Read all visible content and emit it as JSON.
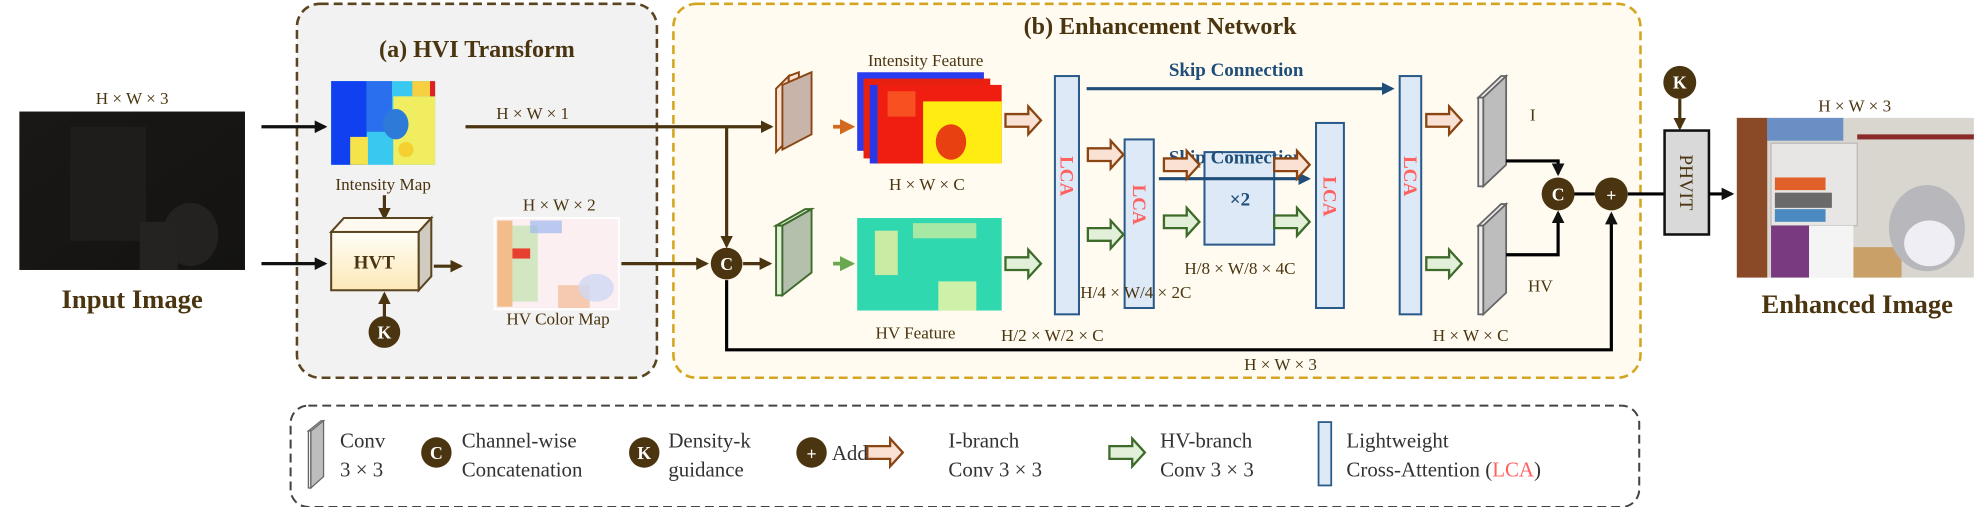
{
  "input": {
    "dims": "H × W × 3",
    "title": "Input Image"
  },
  "hvi": {
    "title": "(a) HVI Transform",
    "intensity_map": "Intensity Map",
    "hvt": "HVT",
    "k": "K",
    "hw1": "H × W × 1",
    "hw2": "H × W × 2",
    "hv_color_map": "HV Color Map"
  },
  "network": {
    "title": "(b) Enhancement Network",
    "concat": "C",
    "intensity_feature": "Intensity Feature",
    "intensity_dims": "H × W × C",
    "hv_feature": "HV Feature",
    "lca": "LCA",
    "dims_half": "H/2 × W/2 × C",
    "dims_quarter": "H/4 × W/4 × 2C",
    "dims_eighth": "H/8 × W/8 × 4C",
    "dims_full": "H × W × C",
    "repeat": "×2",
    "skip_outer": "Skip Connection",
    "skip_inner": "Skip Connection",
    "i_label": "I",
    "hv_label": "HV",
    "concat2": "C",
    "add": "+",
    "residual_dims": "H × W × 3"
  },
  "output": {
    "k": "K",
    "phvit": "PHVIT",
    "dims": "H × W × 3",
    "title": "Enhanced Image"
  },
  "legend": {
    "conv": [
      "Conv",
      "3 × 3"
    ],
    "concat_symbol": "C",
    "concat": [
      "Channel-wise",
      "Concatenation"
    ],
    "density_symbol": "K",
    "density": [
      "Density-k",
      "guidance"
    ],
    "add_symbol": "+",
    "add": "Add",
    "i_branch": [
      "I-branch",
      "Conv 3 × 3"
    ],
    "hv_branch": [
      "HV-branch",
      "Conv 3 × 3"
    ],
    "lca": [
      "Lightweight",
      "Cross-Attention (",
      "LCA",
      ")"
    ]
  },
  "colors": {
    "text_brown": "#4a3510",
    "skip_blue": "#1f4e79",
    "lca_red": "#ff6060",
    "lca_fill": "#dde9f6",
    "i_branch_fill": "#f9e1d3",
    "i_branch_stroke": "#8b4513",
    "hv_branch_fill": "#e2f0d9",
    "hv_branch_stroke": "#3d6b2a",
    "hvi_box_fill": "#f2f2f2",
    "network_box_fill": "#fffbf0",
    "network_box_stroke": "#d4a520"
  }
}
